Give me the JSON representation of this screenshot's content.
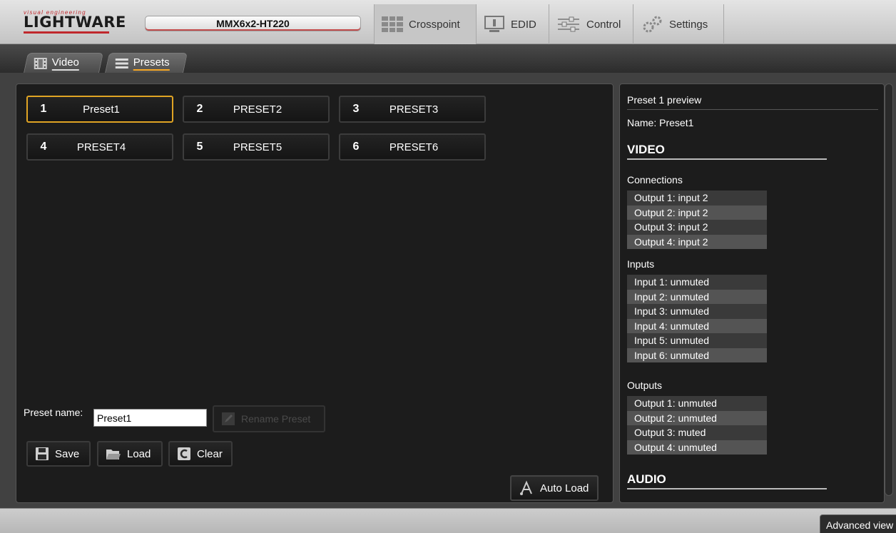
{
  "brand": {
    "tagline": "visual engineering",
    "name": "LIGHTWARE"
  },
  "device": {
    "name": "MMX6x2-HT220"
  },
  "main_tabs": [
    {
      "label": "Crosspoint",
      "icon": "grid-icon"
    },
    {
      "label": "EDID",
      "icon": "monitor-icon"
    },
    {
      "label": "Control",
      "icon": "sliders-icon"
    },
    {
      "label": "Settings",
      "icon": "gears-icon"
    }
  ],
  "sub_tabs": [
    {
      "label": "Video",
      "icon": "film-icon"
    },
    {
      "label": "Presets",
      "icon": "list-icon"
    }
  ],
  "presets": [
    {
      "num": "1",
      "name": "Preset1"
    },
    {
      "num": "2",
      "name": "PRESET2"
    },
    {
      "num": "3",
      "name": "PRESET3"
    },
    {
      "num": "4",
      "name": "PRESET4"
    },
    {
      "num": "5",
      "name": "PRESET5"
    },
    {
      "num": "6",
      "name": "PRESET6"
    }
  ],
  "editor": {
    "preset_name_label": "Preset name:",
    "preset_name_value": "Preset1",
    "rename_label": "Rename Preset",
    "save_label": "Save",
    "load_label": "Load",
    "clear_label": "Clear",
    "autoload_label": "Auto Load"
  },
  "preview": {
    "title": "Preset 1 preview",
    "name": "Name: Preset1",
    "video_heading": "VIDEO",
    "connections_label": "Connections",
    "connections": [
      "Output 1: input 2",
      "Output 2: input 2",
      "Output 3: input 2",
      "Output 4: input 2"
    ],
    "inputs_label": "Inputs",
    "inputs": [
      "Input 1: unmuted",
      "Input 2: unmuted",
      "Input 3: unmuted",
      "Input 4: unmuted",
      "Input 5: unmuted",
      "Input 6: unmuted"
    ],
    "outputs_label": "Outputs",
    "outputs": [
      "Output 1: unmuted",
      "Output 2: unmuted",
      "Output 3: muted",
      "Output 4: unmuted"
    ],
    "audio_heading": "AUDIO"
  },
  "footer": {
    "advanced_label": "Advanced view"
  },
  "colors": {
    "accent": "#e0a424",
    "brand_red": "#c0282d"
  }
}
